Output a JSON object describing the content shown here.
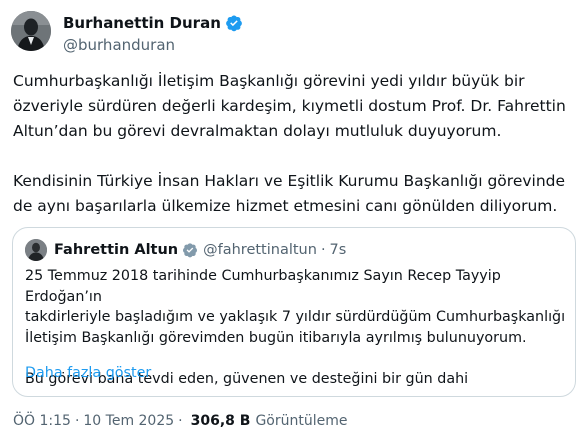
{
  "author": {
    "name": "Burhanettin Duran",
    "handle": "@burhanduran",
    "verified_color": "#1d9bf0"
  },
  "tweet": {
    "text": "Cumhurbaşkanlığı İletişim Başkanlığı görevini yedi yıldır büyük bir\nözveriyle sürdüren değerli kardeşim, kıymetli dostum Prof. Dr. Fahrettin\nAltun’dan bu görevi devralmaktan dolayı mutluluk duyuyorum.\n\nKendisinin Türkiye İnsan Hakları ve Eşitlik Kurumu Başkanlığı görevinde\nde aynı başarılarla ülkemize hizmet etmesini canı gönülden diliyorum."
  },
  "quote": {
    "name": "Fahrettin Altun",
    "handle": "@fahrettinaltun",
    "dot": "·",
    "time": "7s",
    "text": "25 Temmuz 2018 tarihinde Cumhurbaşkanımız Sayın Recep Tayyip Erdoğan’ın\ntakdirleriyle başladığım ve yaklaşık 7 yıldır sürdürdüğüm Cumhurbaşkanlığı\nİletişim Başkanlığı görevimden bugün itibarıyla ayrılmış bulunuyorum.\n\nBu görevi bana tevdi eden, güvenen ve desteğini bir gün dahi",
    "show_more": "Daha fazla göster"
  },
  "meta": {
    "time": "ÖÖ 1:15",
    "dot1": "·",
    "date": "10 Tem 2025",
    "dot2": "·",
    "views": "306,8 B",
    "views_label": "Görüntüleme"
  },
  "colors": {
    "accent": "#1d9bf0",
    "secondary_text": "#536471",
    "border": "#cfd9de"
  }
}
